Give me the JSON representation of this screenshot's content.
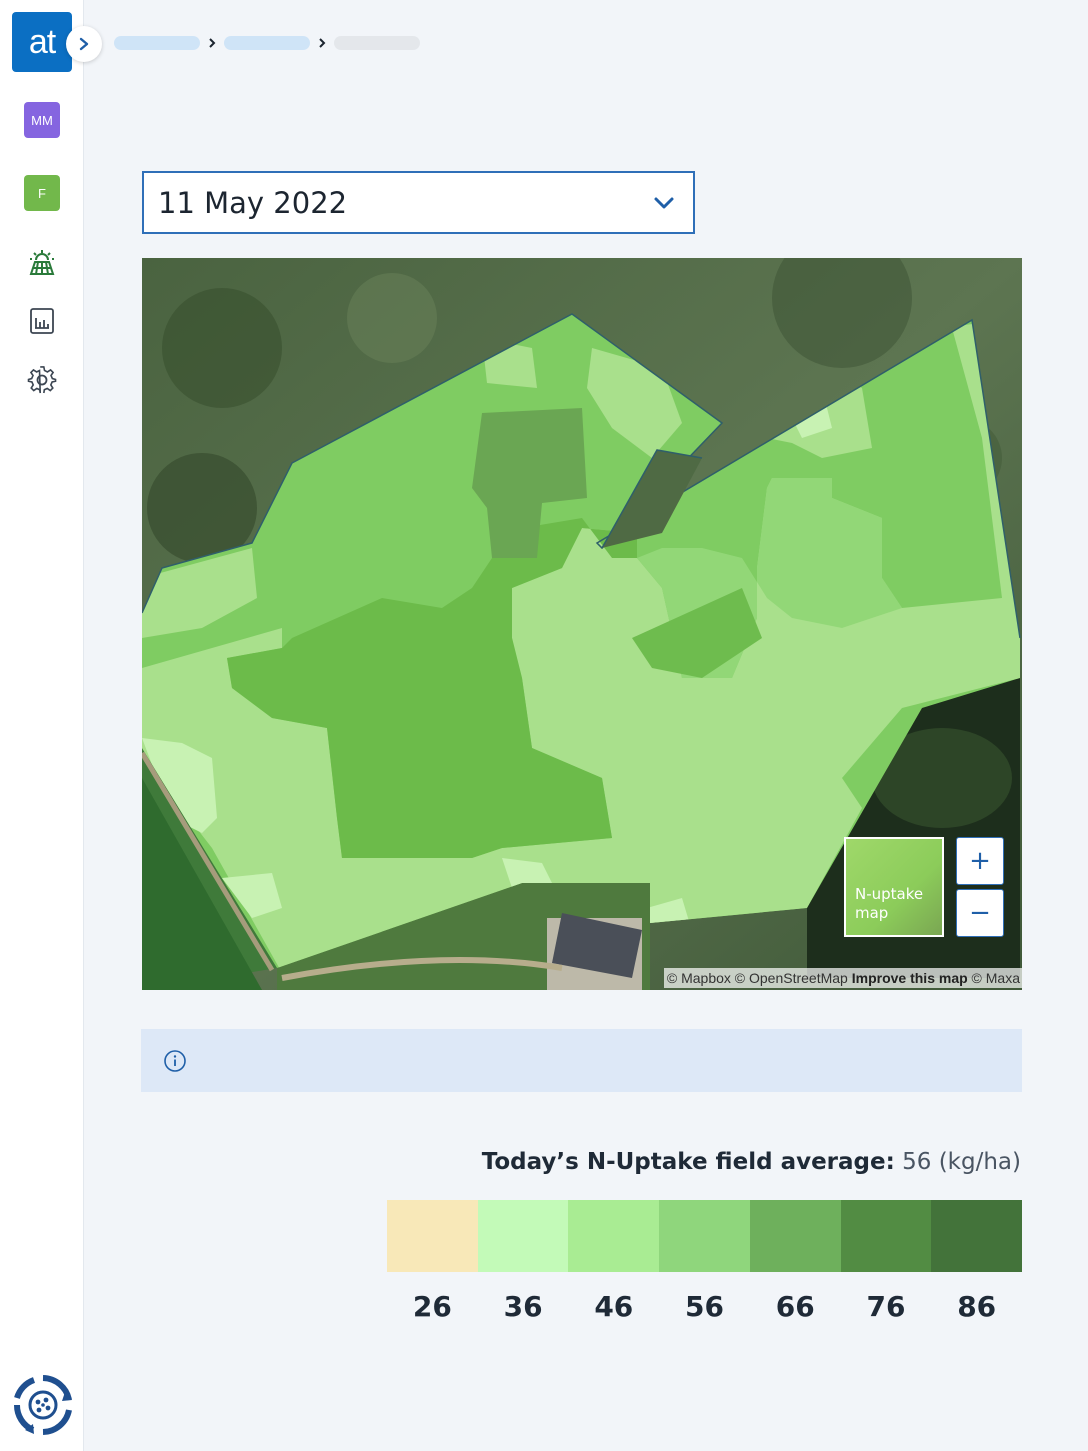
{
  "app": {
    "logo_text": "at"
  },
  "sidebar": {
    "badges": [
      {
        "label": "MM",
        "color": "#8565e0"
      },
      {
        "label": "F",
        "color": "#72b84b"
      }
    ],
    "icons": [
      "field-icon",
      "report-icon",
      "settings-icon"
    ]
  },
  "date_select": {
    "value": "11 May 2022"
  },
  "map": {
    "layer_toggle_label": "N-uptake map",
    "zoom_in_label": "+",
    "zoom_out_label": "−",
    "attribution": {
      "mapbox": "© Mapbox",
      "osm": "© OpenStreetMap",
      "improve": "Improve this map",
      "maxar": "© Maxa"
    }
  },
  "summary": {
    "label": "Today’s N-Uptake field average:",
    "value": "56 (kg/ha)"
  },
  "legend": {
    "items": [
      {
        "label": "26",
        "color": "#f8e8b8"
      },
      {
        "label": "36",
        "color": "#c3fab8"
      },
      {
        "label": "46",
        "color": "#a9ec93"
      },
      {
        "label": "56",
        "color": "#8fd67c"
      },
      {
        "label": "66",
        "color": "#6eb05c"
      },
      {
        "label": "76",
        "color": "#528c43"
      },
      {
        "label": "86",
        "color": "#43733a"
      }
    ]
  }
}
